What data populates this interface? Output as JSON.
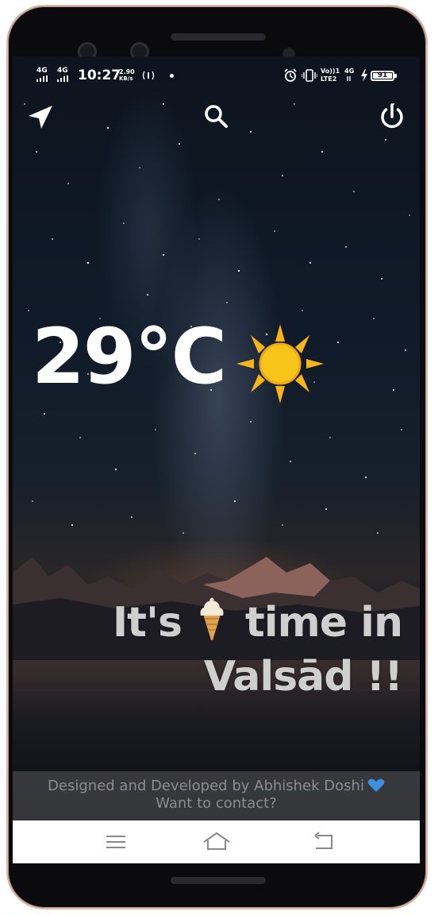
{
  "status_bar": {
    "network_1": "4G",
    "network_2": "4G",
    "time": "10:27",
    "speed_value": "2.90",
    "speed_unit": "KB/s",
    "volte_line1": "Vo))1",
    "volte_line2": "LTE2",
    "network_3": "4G",
    "battery_level": "91",
    "icons": [
      "signal-icon",
      "signal-icon",
      "hotspot-icon",
      "dot-icon",
      "alarm-icon",
      "vibrate-icon",
      "charging-icon",
      "battery-icon"
    ]
  },
  "top_bar": {
    "icons": [
      "location-arrow-icon",
      "search-icon",
      "power-icon"
    ]
  },
  "weather": {
    "temperature": "29°C",
    "condition_icon": "sun-icon"
  },
  "message": {
    "line1_before": "It's",
    "emoji_icon": "ice-cream-icon",
    "line1_after": "time in",
    "line2": "Valsād !!"
  },
  "footer": {
    "credit": "Designed and Developed by Abhishek Doshi",
    "heart_icon": "blue-heart-icon",
    "contact": "Want to contact?"
  },
  "nav_bar": {
    "icons": [
      "menu-icon",
      "home-icon",
      "back-icon"
    ]
  },
  "colors": {
    "sun": "#f7c51a",
    "heart": "#3d8fe0",
    "message_text": "#cfcfcf",
    "footer_text": "#8d8d90"
  }
}
